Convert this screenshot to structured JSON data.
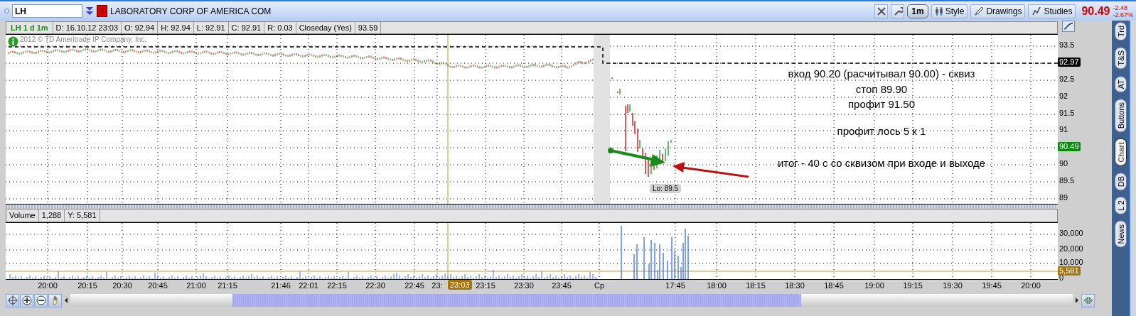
{
  "toolbar": {
    "symbol": "LH",
    "link_badge": "1",
    "company": "LABORATORY CORP OF AMERICA COM",
    "buttons": [
      {
        "kind": "pill",
        "label": "1m"
      },
      {
        "kind": "style",
        "label": "Style"
      },
      {
        "kind": "drawings",
        "label": "Drawings"
      },
      {
        "kind": "studies",
        "label": "Studies"
      }
    ],
    "last_price": "90.49",
    "change": "-2.48",
    "change_percent": "-2.67%"
  },
  "info_bar": {
    "title": "LH 1 d 1m",
    "fields": [
      "D: 16.10.12 23:03",
      "O: 92.94",
      "H: 92.94",
      "L: 92.91",
      "C: 92.91",
      "R: 0.03",
      "Closeday (Yes)",
      "93.59"
    ]
  },
  "price_chart": {
    "copyright": "2012 © TD Ameritrade IP Company, Inc.",
    "y_ticks": [
      "93.5",
      "92.5",
      "92",
      "91.5",
      "91",
      "90",
      "89.5",
      "89"
    ],
    "y_badges": [
      {
        "label": "92.97",
        "color": "#000000"
      },
      {
        "label": "90.49",
        "color": "#0a8a0a"
      }
    ],
    "low_label": "Lo: 89.5",
    "notes": [
      "вход 90.20 (расчитывал 90.00) - сквиз",
      "стоп 89.90",
      "профит 91.50",
      "профит лось 5 к 1",
      "итог - 40 с со сквизом при входе и выходе"
    ]
  },
  "volume": {
    "label": "Volume",
    "value": "1,288",
    "y_value": "Y: 5,581",
    "y_ticks": [
      "30,000",
      "20,000",
      "10,000",
      "0"
    ],
    "badge": "5,581"
  },
  "x_axis": {
    "labels": [
      "20:00",
      "20:15",
      "20:30",
      "20:45",
      "21:00",
      "21:15",
      "21:46",
      "22:01",
      "22:15",
      "22:30",
      "22:45",
      "23:",
      "23:15",
      "23:30",
      "23:45",
      "Cp",
      "17:45",
      "18:00",
      "18:15",
      "18:30",
      "18:45",
      "19:00",
      "19:15",
      "19:30",
      "19:45",
      "20:00"
    ],
    "cursor_label": "23:03"
  },
  "side_tabs": [
    {
      "label": "Trd",
      "selected": false
    },
    {
      "label": "T&S",
      "selected": false
    },
    {
      "label": "AT",
      "selected": false
    },
    {
      "label": "Buttons",
      "selected": false
    },
    {
      "label": "Chart",
      "selected": true
    },
    {
      "label": "DB",
      "selected": false
    },
    {
      "label": "L 2",
      "selected": false
    },
    {
      "label": "News",
      "selected": false
    }
  ]
}
